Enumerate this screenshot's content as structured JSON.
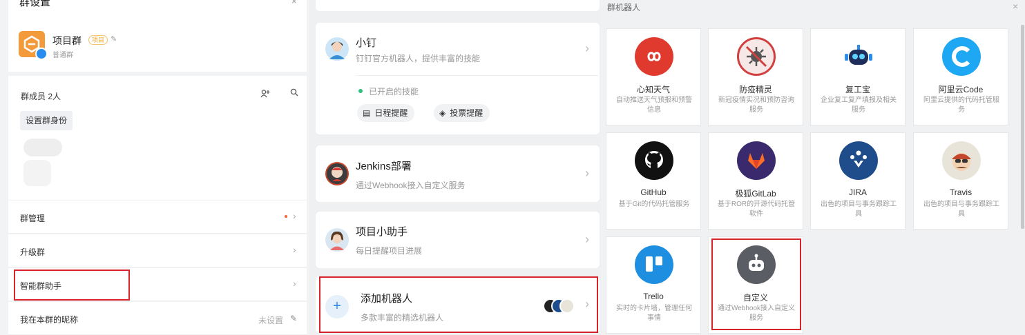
{
  "group_settings": {
    "title": "群设置",
    "close": "×",
    "group_name": "项目群",
    "group_tag": "项目",
    "group_type": "普通群",
    "members_label": "群成员 2人",
    "set_identity": "设置群身份",
    "rows": [
      {
        "label": "群管理"
      },
      {
        "label": "升级群"
      },
      {
        "label": "智能群助手"
      },
      {
        "label": "我在本群的昵称",
        "value": "未设置"
      }
    ]
  },
  "robot_list": {
    "cards": [
      {
        "name": "小钉",
        "desc": "钉钉官方机器人，提供丰富的技能"
      },
      {
        "name": "Jenkins部署",
        "desc": "通过Webhook接入自定义服务"
      },
      {
        "name": "项目小助手",
        "desc": "每日提醒项目进展"
      }
    ],
    "skills_label": "已开启的技能",
    "skills": [
      {
        "icon": "calendar-icon",
        "label": "日程提醒"
      },
      {
        "icon": "vote-icon",
        "label": "投票提醒"
      }
    ],
    "add_robot": {
      "name": "添加机器人",
      "desc": "多款丰富的精选机器人",
      "plus": "+"
    }
  },
  "robot_gallery": {
    "title": "群机器人",
    "close": "×",
    "tiles": [
      {
        "name": "心知天气",
        "desc": "自动推送天气预报和预警信息",
        "icon": "infinity-icon",
        "color": "#e03a2f"
      },
      {
        "name": "防疫精灵",
        "desc": "新冠疫情实况和预防咨询服务",
        "icon": "virus-icon",
        "color": "#f7e8e8"
      },
      {
        "name": "复工宝",
        "desc": "企业复工复产填报及相关服务",
        "icon": "robot-icon",
        "color": "#ffffff"
      },
      {
        "name": "阿里云Code",
        "desc": "阿里云提供的代码托管服务",
        "icon": "code-icon",
        "color": "#1ea7f2"
      },
      {
        "name": "GitHub",
        "desc": "基于Git的代码托管服务",
        "icon": "github-icon",
        "color": "#111111"
      },
      {
        "name": "极狐GitLab",
        "desc": "基于ROR的开源代码托管软件",
        "icon": "gitlab-icon",
        "color": "#3a2a6d"
      },
      {
        "name": "JIRA",
        "desc": "出色的项目与事务跟踪工具",
        "icon": "jira-icon",
        "color": "#1f4d8c"
      },
      {
        "name": "Travis",
        "desc": "出色的项目与事务跟踪工具",
        "icon": "travis-icon",
        "color": "#e8e4d9"
      },
      {
        "name": "Trello",
        "desc": "实时的卡片墙，管理任何事情",
        "icon": "trello-icon",
        "color": "#1e8fe0"
      },
      {
        "name": "自定义",
        "desc": "通过Webhook接入自定义服务",
        "icon": "custom-robot-icon",
        "color": "#5a5d63"
      }
    ]
  }
}
